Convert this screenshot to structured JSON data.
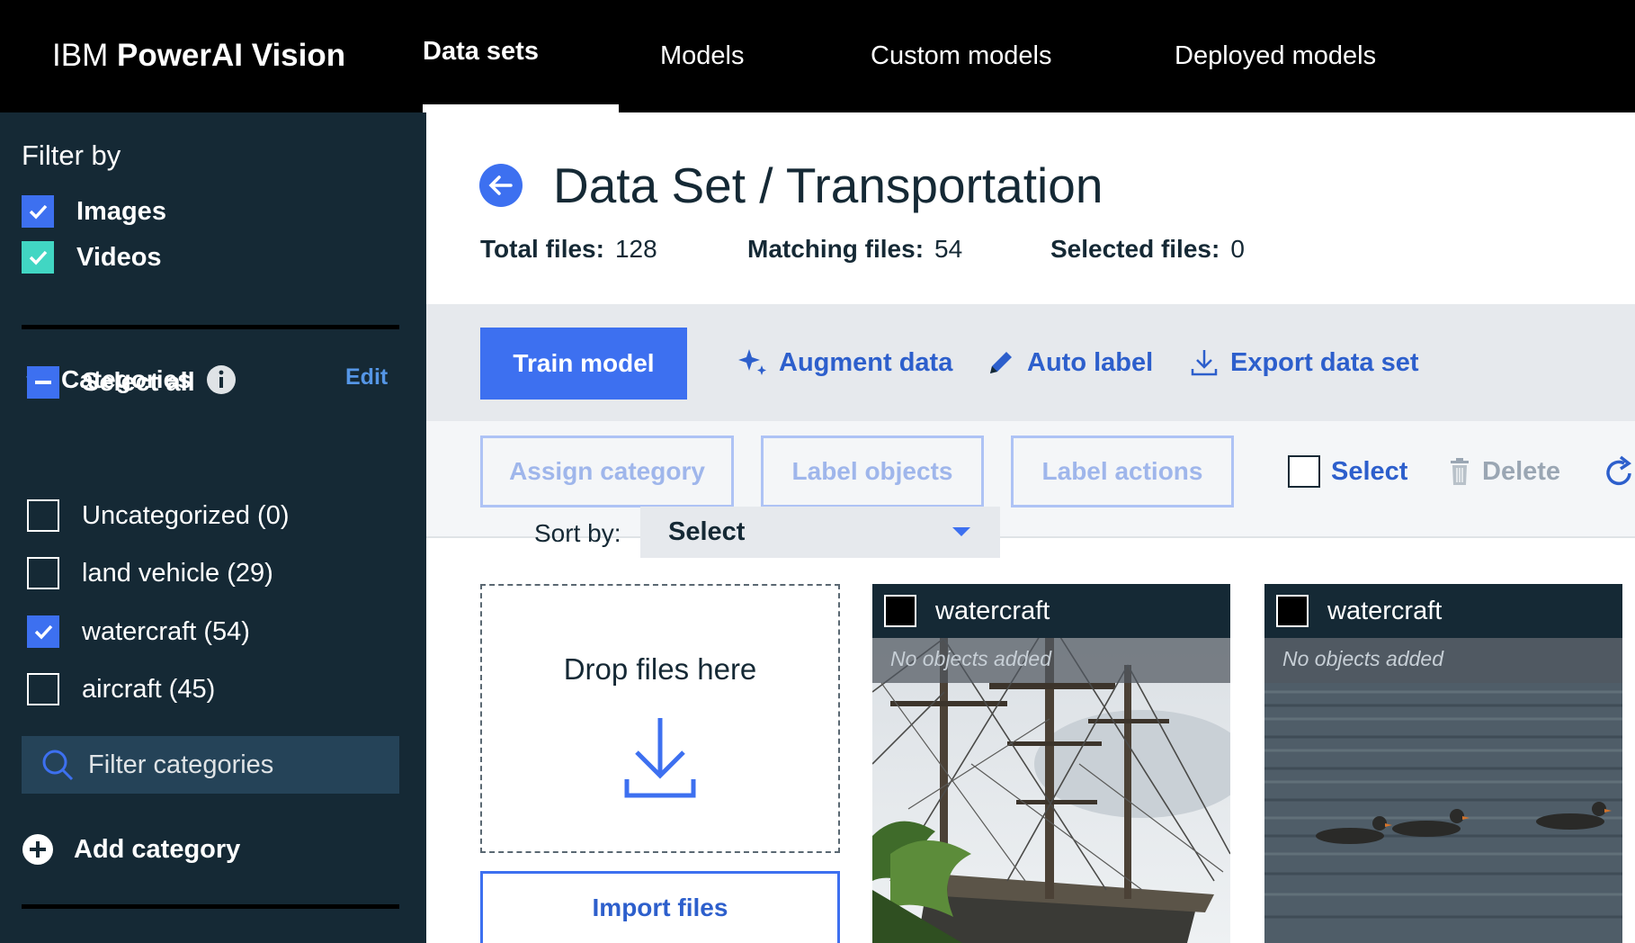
{
  "app": {
    "brand_light": "IBM",
    "brand_bold": "PowerAI Vision"
  },
  "nav": {
    "tabs": [
      {
        "label": "Data sets",
        "active": true
      },
      {
        "label": "Models",
        "active": false
      },
      {
        "label": "Custom models",
        "active": false
      },
      {
        "label": "Deployed models",
        "active": false
      }
    ]
  },
  "sidebar": {
    "filter_title": "Filter by",
    "types": [
      {
        "label": "Images",
        "checked": true,
        "color": "#3d70f0"
      },
      {
        "label": "Videos",
        "checked": true,
        "color": "#41d6c3"
      }
    ],
    "categories_title": "Categories",
    "edit_label": "Edit",
    "select_all": "Select all",
    "categories": [
      {
        "label": "Uncategorized (0)",
        "checked": false
      },
      {
        "label": "land vehicle (29)",
        "checked": false
      },
      {
        "label": "watercraft (54)",
        "checked": true
      },
      {
        "label": "aircraft (45)",
        "checked": false
      }
    ],
    "filter_placeholder": "Filter categories",
    "add_category": "Add category"
  },
  "main": {
    "title": "Data Set / Transportation",
    "stats": [
      {
        "key": "Total files:",
        "value": "128"
      },
      {
        "key": "Matching files:",
        "value": "54"
      },
      {
        "key": "Selected files:",
        "value": "0"
      }
    ],
    "toolbar": {
      "train": "Train model",
      "augment": "Augment data",
      "auto_label": "Auto label",
      "export": "Export data set"
    },
    "actions": {
      "assign": "Assign category",
      "label_objects": "Label objects",
      "label_actions": "Label actions",
      "select": "Select",
      "delete": "Delete"
    },
    "sort": {
      "label": "Sort by:",
      "value": "Select"
    },
    "dropzone": {
      "text": "Drop files here",
      "import": "Import files"
    },
    "files": [
      {
        "category": "watercraft",
        "status": "No objects added",
        "scene": "tall-ship"
      },
      {
        "category": "watercraft",
        "status": "No objects added",
        "scene": "ducks-on-water"
      }
    ]
  },
  "colors": {
    "nav_bg": "#000000",
    "sidebar_bg": "#152935",
    "accent": "#3d70f0",
    "link": "#2d5fcc"
  }
}
